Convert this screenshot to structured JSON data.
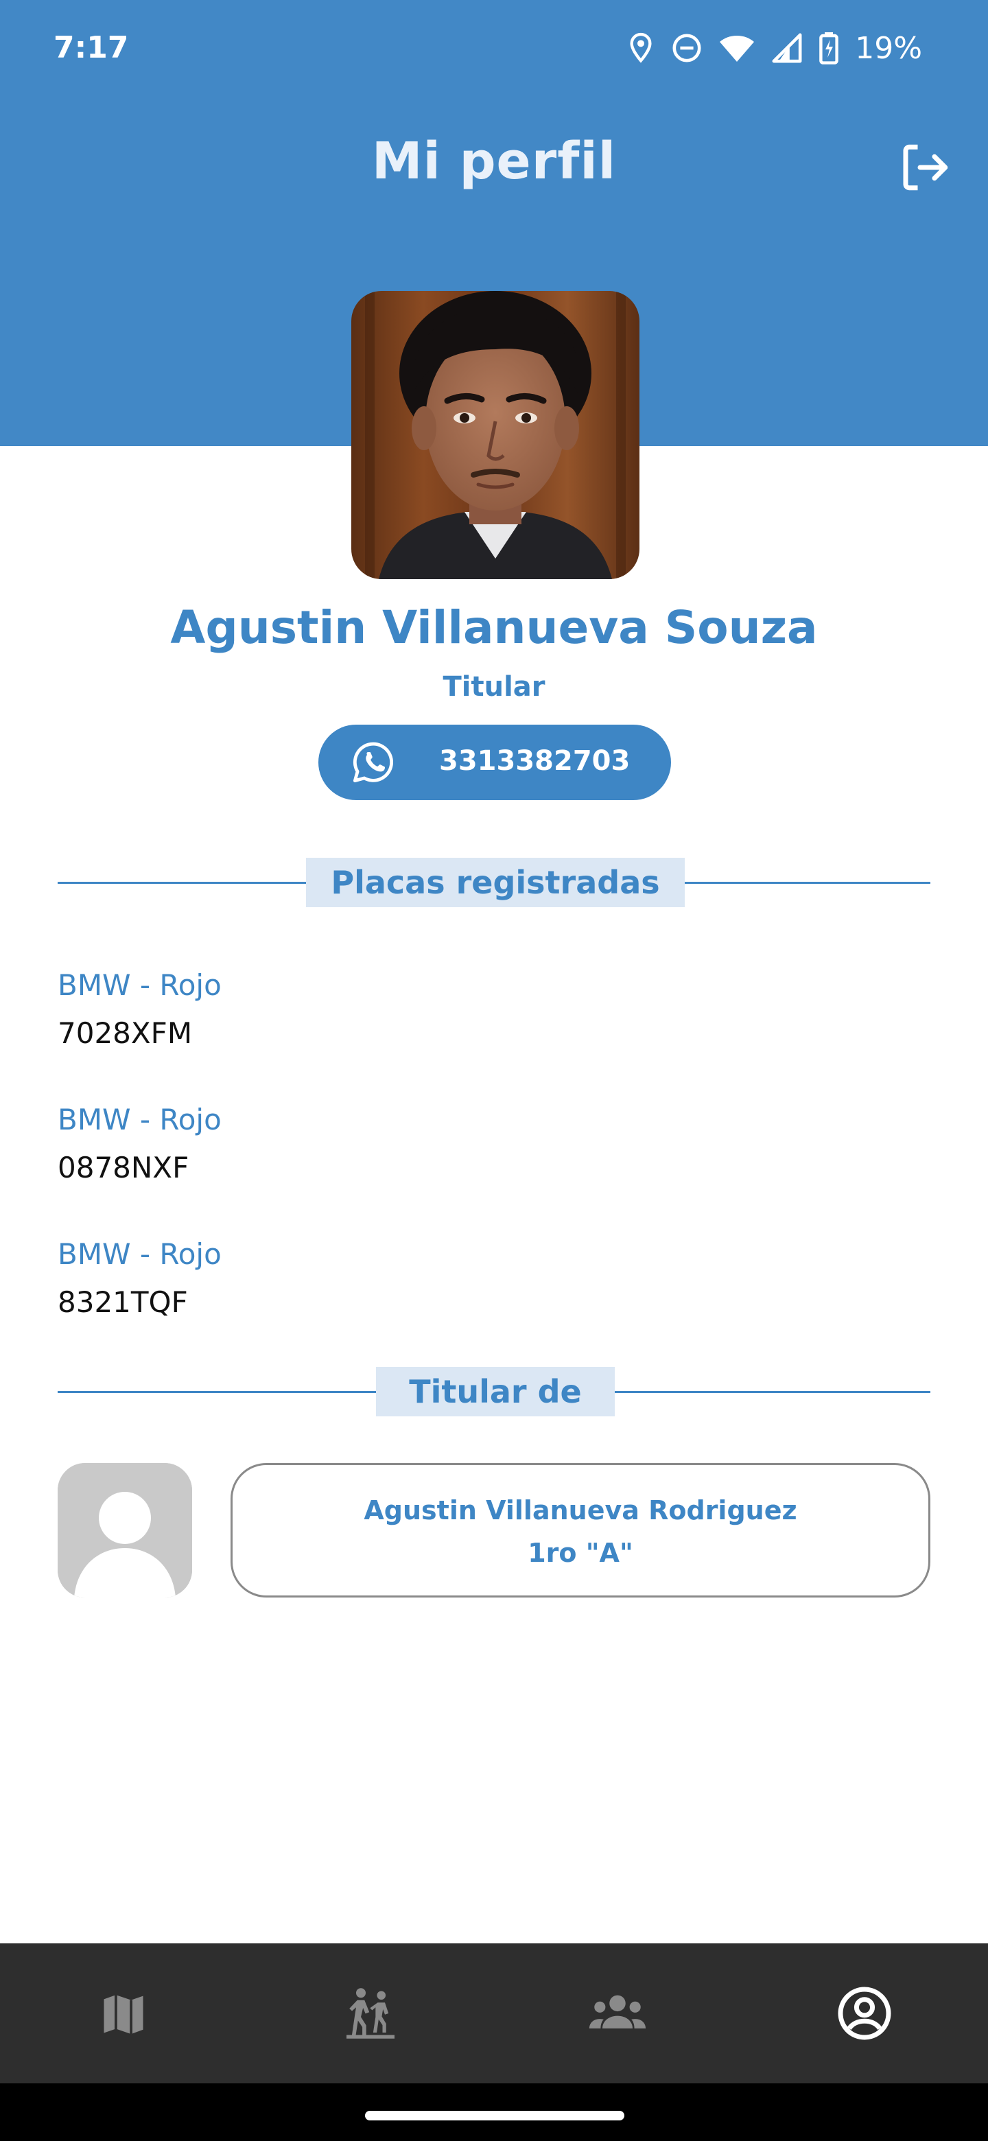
{
  "status_bar": {
    "time": "7:17",
    "battery": "19%",
    "icons": [
      "location-icon",
      "dnd-icon",
      "wifi-icon",
      "signal-icon",
      "battery-charging-icon"
    ]
  },
  "app_bar": {
    "title": "Mi perfil",
    "action_icon": "logout-icon"
  },
  "profile": {
    "name": "Agustin Villanueva Souza",
    "role": "Titular",
    "phone": "3313382703",
    "phone_icon": "whatsapp-icon"
  },
  "plates_section": {
    "title": "Placas registradas",
    "items": [
      {
        "model": "BMW - Rojo",
        "plate": "7028XFM"
      },
      {
        "model": "BMW - Rojo",
        "plate": "0878NXF"
      },
      {
        "model": "BMW - Rojo",
        "plate": "8321TQF"
      }
    ]
  },
  "holder_section": {
    "title": "Titular de",
    "members": [
      {
        "name": "Agustin Villanueva Rodriguez",
        "unit": "1ro \"A\""
      }
    ]
  },
  "bottom_nav": {
    "items": [
      {
        "icon": "map-icon",
        "active": false
      },
      {
        "icon": "pedestrian-crossing-icon",
        "active": false
      },
      {
        "icon": "group-icon",
        "active": false
      },
      {
        "icon": "account-circle-icon",
        "active": true
      }
    ]
  },
  "colors": {
    "primary": "#4288c6",
    "accent_text": "#3e86c5",
    "section_label_bg": "#dbe7f4",
    "nav_bg": "#2e2e2e",
    "nav_inactive": "#8a8a8a",
    "nav_active": "#ffffff"
  }
}
